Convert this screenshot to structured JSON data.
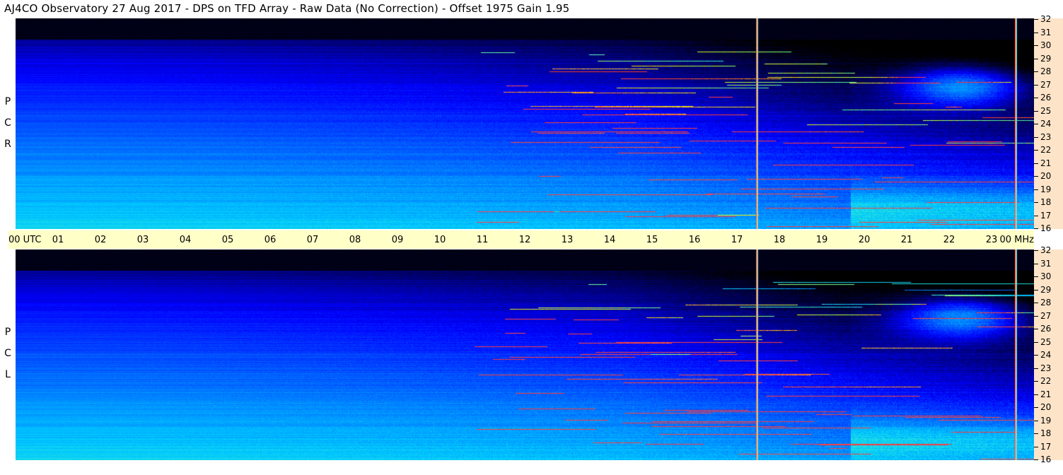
{
  "title": "AJ4CO Observatory  27 Aug 2017  -  DPS on TFD Array  -  Raw Data (No Correction)  -  Offset 1975  Gain 1.95",
  "panels": [
    {
      "id": "rcp",
      "label_letters": [
        "P",
        "C",
        "R"
      ]
    },
    {
      "id": "lcp",
      "label_letters": [
        "P",
        "C",
        "L"
      ]
    }
  ],
  "time_axis": {
    "first_label": "00  UTC",
    "last_label": "00 MHz",
    "ticks": [
      "01",
      "02",
      "03",
      "04",
      "05",
      "06",
      "07",
      "08",
      "09",
      "10",
      "11",
      "12",
      "13",
      "14",
      "15",
      "16",
      "17",
      "18",
      "19",
      "20",
      "21",
      "22",
      "23"
    ]
  },
  "chart_data": {
    "type": "heatmap",
    "title": "AJ4CO Observatory  27 Aug 2017  -  DPS on TFD Array  -  Raw Data (No Correction)  -  Offset 1975  Gain 1.95",
    "x_unit": "UTC hour",
    "y_unit": "MHz",
    "xlim": [
      0,
      24
    ],
    "ylim": [
      16,
      32
    ],
    "y_ticks": [
      32,
      31,
      30,
      29,
      28,
      27,
      26,
      25,
      24,
      23,
      22,
      21,
      20,
      19,
      18,
      17,
      16
    ],
    "series": [
      {
        "name": "R C P"
      },
      {
        "name": "L C P"
      }
    ],
    "interference_vertical_lines_hours": [
      17.45,
      23.55
    ],
    "colormap": [
      "#000000",
      "#00006e",
      "#0000ff",
      "#0064ff",
      "#00c8ff",
      "#50ffb4",
      "#ffff00",
      "#ff3c3c"
    ]
  }
}
